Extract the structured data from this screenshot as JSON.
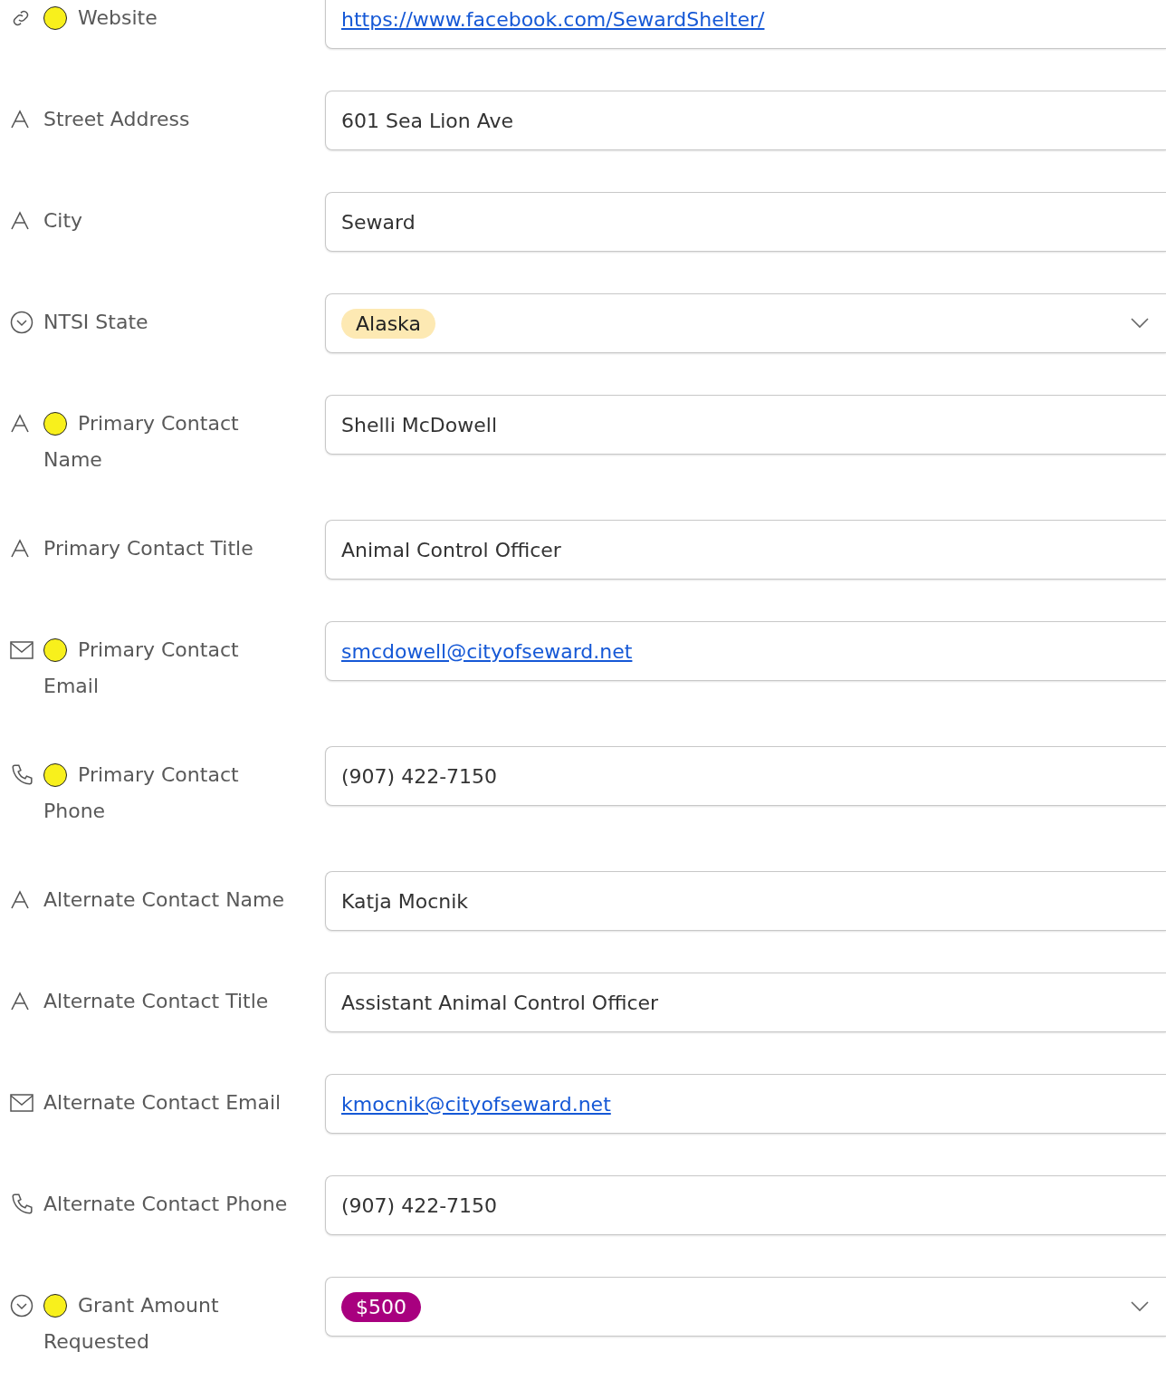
{
  "fields": [
    {
      "kind": "url",
      "label": "Website",
      "flagged": true,
      "value": "https://www.facebook.com/SewardShelter/"
    },
    {
      "kind": "text",
      "label": "Street Address",
      "flagged": false,
      "value": "601 Sea Lion Ave"
    },
    {
      "kind": "text",
      "label": "City",
      "flagged": false,
      "value": "Seward"
    },
    {
      "kind": "select",
      "label": "NTSI State",
      "flagged": false,
      "tag": {
        "label": "Alaska",
        "color": "#fde9b3"
      }
    },
    {
      "kind": "text",
      "label": "Primary Contact Name",
      "flagged": true,
      "value": "Shelli McDowell"
    },
    {
      "kind": "text",
      "label": "Primary Contact Title",
      "flagged": false,
      "value": "Animal Control Officer"
    },
    {
      "kind": "email",
      "label": "Primary Contact Email",
      "flagged": true,
      "value": "smcdowell@cityofseward.net"
    },
    {
      "kind": "phone",
      "label": "Primary Contact Phone",
      "flagged": true,
      "value": "(907) 422-7150"
    },
    {
      "kind": "text",
      "label": "Alternate Contact Name",
      "flagged": false,
      "value": "Katja Mocnik"
    },
    {
      "kind": "text",
      "label": "Alternate Contact Title",
      "flagged": false,
      "value": "Assistant Animal Control Officer"
    },
    {
      "kind": "email",
      "label": "Alternate Contact Email",
      "flagged": false,
      "value": "kmocnik@cityofseward.net"
    },
    {
      "kind": "phone",
      "label": "Alternate Contact Phone",
      "flagged": false,
      "value": "(907) 422-7150"
    },
    {
      "kind": "select",
      "label": "Grant Amount Requested",
      "flagged": true,
      "tag": {
        "label": "$500",
        "color": "#a8007f"
      }
    }
  ]
}
